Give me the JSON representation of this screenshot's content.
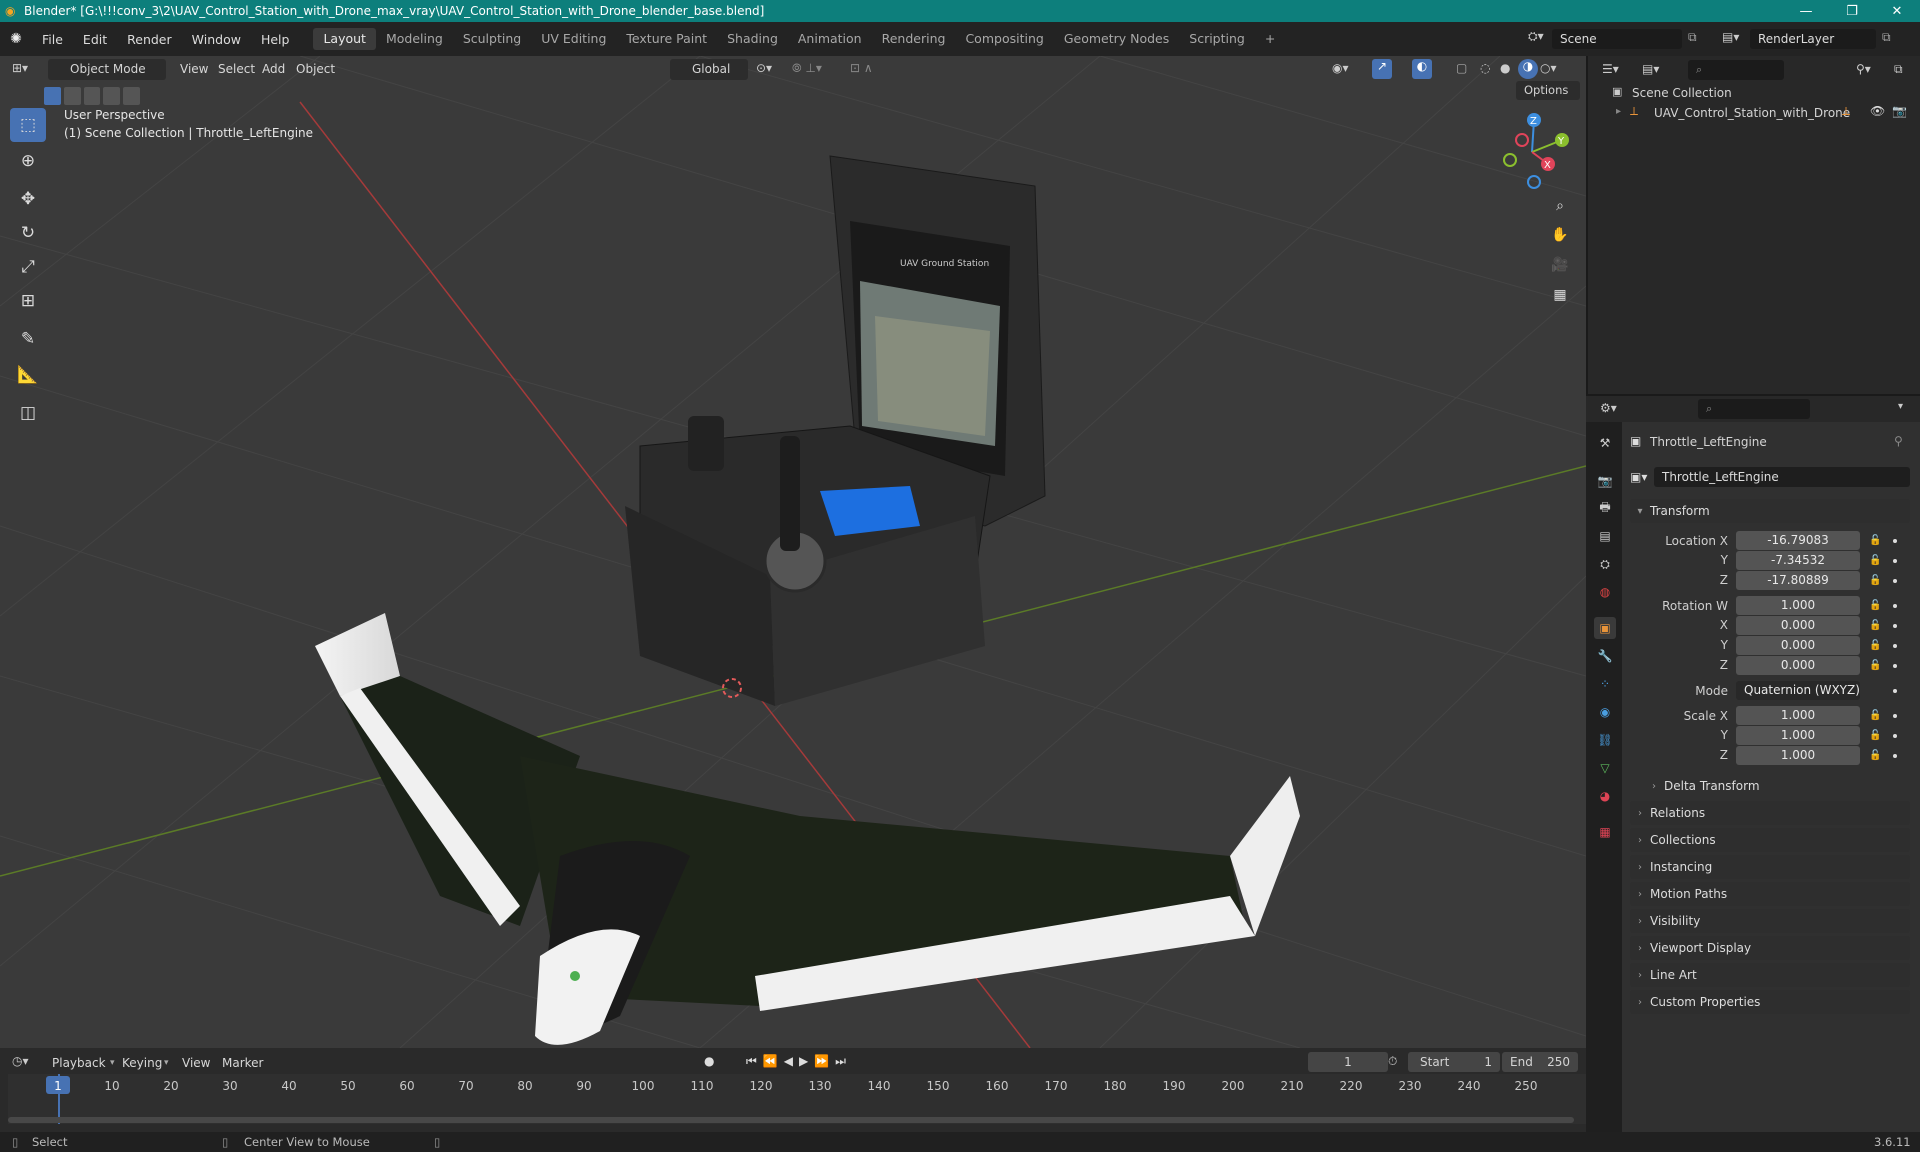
{
  "window": {
    "title": "Blender* [G:\\!!!conv_3\\2\\UAV_Control_Station_with_Drone_max_vray\\UAV_Control_Station_with_Drone_blender_base.blend]",
    "minimize": "—",
    "maximize": "❐",
    "close": "✕"
  },
  "menu": [
    "File",
    "Edit",
    "Render",
    "Window",
    "Help"
  ],
  "workspaces": [
    "Layout",
    "Modeling",
    "Sculpting",
    "UV Editing",
    "Texture Paint",
    "Shading",
    "Animation",
    "Rendering",
    "Compositing",
    "Geometry Nodes",
    "Scripting",
    "+"
  ],
  "scene": {
    "name": "Scene",
    "render_layer": "RenderLayer"
  },
  "viewport": {
    "mode": "Object Mode",
    "menus": [
      "View",
      "Select",
      "Add",
      "Object"
    ],
    "orientation": "Global",
    "options": "Options",
    "perspective": "User Perspective",
    "collection_info": "(1) Scene Collection | Throttle_LeftEngine",
    "screen_label": "UAV Ground Station"
  },
  "gizmo": {
    "x": "X",
    "y": "Y",
    "z": "Z"
  },
  "outliner": {
    "root": "Scene Collection",
    "item": "UAV_Control_Station_with_Drone"
  },
  "properties": {
    "object_name": "Throttle_LeftEngine",
    "data_name": "Throttle_LeftEngine",
    "transform": "Transform",
    "location_label": "Location X",
    "location": [
      "-16.79083",
      "-7.34532",
      "-17.80889"
    ],
    "rotation_label": "Rotation W",
    "rotation": [
      "1.000",
      "0.000",
      "0.000",
      "0.000"
    ],
    "mode_label": "Mode",
    "mode": "Quaternion (WXYZ)",
    "scale_label": "Scale X",
    "scale": [
      "1.000",
      "1.000",
      "1.000"
    ],
    "axis": [
      "Y",
      "Z",
      "X"
    ],
    "delta": "Delta Transform",
    "panels": [
      "Relations",
      "Collections",
      "Instancing",
      "Motion Paths",
      "Visibility",
      "Viewport Display",
      "Line Art",
      "Custom Properties"
    ]
  },
  "timeline": {
    "menus": [
      "Playback",
      "Keying",
      "View",
      "Marker"
    ],
    "current_frame": "1",
    "start_label": "Start",
    "start": "1",
    "end_label": "End",
    "end": "250",
    "ticks": [
      "1",
      "10",
      "20",
      "30",
      "40",
      "50",
      "60",
      "70",
      "80",
      "90",
      "100",
      "110",
      "120",
      "130",
      "140",
      "150",
      "160",
      "170",
      "180",
      "190",
      "200",
      "210",
      "220",
      "230",
      "240",
      "250"
    ]
  },
  "status": {
    "left": "Select",
    "middle": "Center View to Mouse",
    "version": "3.6.11"
  },
  "colors": {
    "title": "#0d7f7c",
    "accent": "#4772b3",
    "x_axis": "#e0445a",
    "y_axis": "#8bbf2e",
    "z_axis": "#3d8fe0"
  }
}
